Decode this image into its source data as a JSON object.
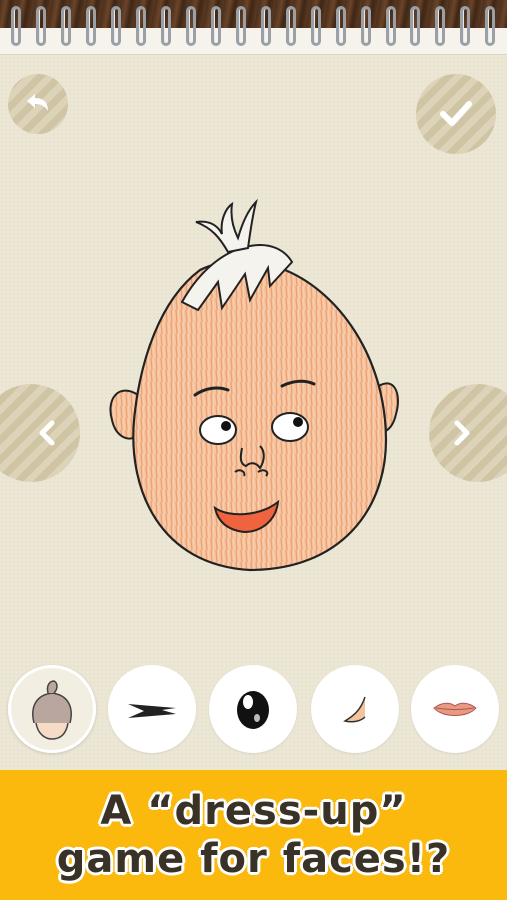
{
  "toolbar": {
    "back_icon": "undo-arrow-icon",
    "confirm_icon": "checkmark-icon"
  },
  "navigation": {
    "prev_icon": "chevron-left-icon",
    "next_icon": "chevron-right-icon"
  },
  "parts": [
    {
      "name": "hair",
      "icon": "hair-icon",
      "selected": true
    },
    {
      "name": "eyebrows",
      "icon": "eyebrow-icon",
      "selected": false
    },
    {
      "name": "eyes",
      "icon": "eye-icon",
      "selected": false
    },
    {
      "name": "nose",
      "icon": "nose-icon",
      "selected": false
    },
    {
      "name": "mouth",
      "icon": "lips-icon",
      "selected": false
    }
  ],
  "banner": {
    "line1": "A “dress-up”",
    "line2": "game for faces!?"
  },
  "colors": {
    "banner_bg": "#fbb80d",
    "paper": "#ece6d5",
    "skin": "#f2b48c",
    "mouth": "#f0633f"
  }
}
